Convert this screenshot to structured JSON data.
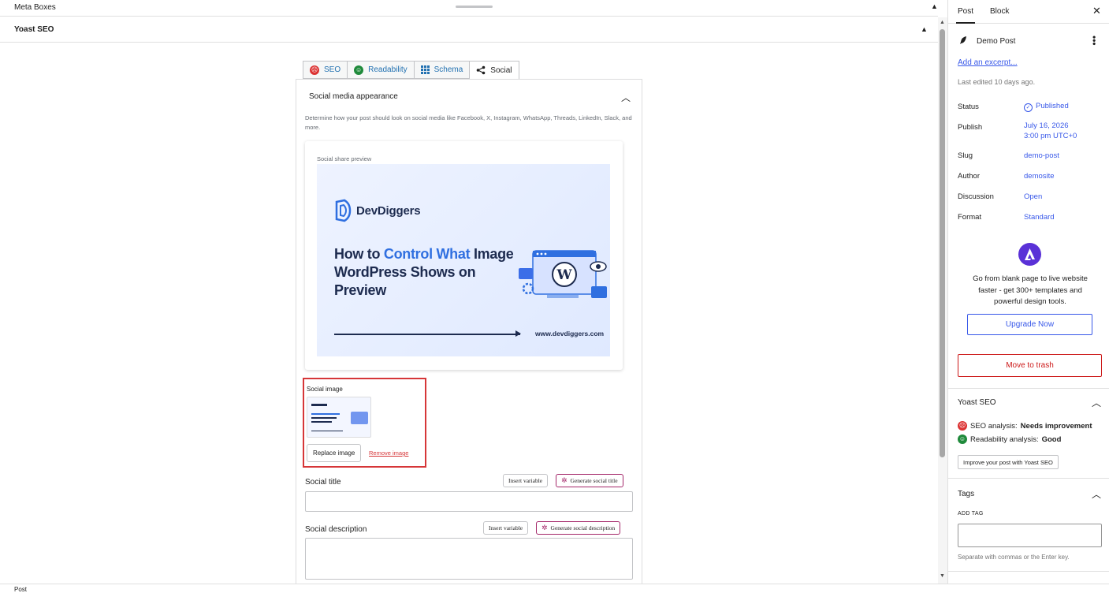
{
  "meta_boxes": {
    "label": "Meta Boxes"
  },
  "yoast_box": {
    "label": "Yoast SEO"
  },
  "tabs": [
    {
      "label": "SEO",
      "icon": "sad-face-icon"
    },
    {
      "label": "Readability",
      "icon": "happy-face-icon"
    },
    {
      "label": "Schema",
      "icon": "grid-icon"
    },
    {
      "label": "Social",
      "icon": "share-icon"
    }
  ],
  "social": {
    "section_title": "Social media appearance",
    "description": "Determine how your post should look on social media like Facebook, X, Instagram, WhatsApp, Threads, LinkedIn, Slack, and more.",
    "preview_title": "Social share preview",
    "preview": {
      "brand": "DevDiggers",
      "headline_pre": "How to ",
      "headline_highlight": "Control What",
      "headline_post": " Image WordPress Shows on Preview",
      "site": "www.devdiggers.com"
    },
    "image_label": "Social image",
    "replace_label": "Replace image",
    "remove_label": "Remove image",
    "title_label": "Social title",
    "desc_label": "Social description",
    "insert_variable": "Insert variable",
    "generate_title": "Generate social title",
    "generate_desc": "Generate social description",
    "title_value": "",
    "desc_value": ""
  },
  "footer": {
    "label": "Post"
  },
  "sidebar": {
    "tab_post": "Post",
    "tab_block": "Block",
    "post_name": "Demo Post",
    "excerpt_link": "Add an excerpt...",
    "last_edited": "Last edited 10 days ago.",
    "rows": {
      "status_k": "Status",
      "status_v": "Published",
      "publish_k": "Publish",
      "publish_v1": "July 16, 2026",
      "publish_v2": "3:00 pm UTC+0",
      "slug_k": "Slug",
      "slug_v": "demo-post",
      "author_k": "Author",
      "author_v": "demosite",
      "discussion_k": "Discussion",
      "discussion_v": "Open",
      "format_k": "Format",
      "format_v": "Standard"
    },
    "promo": "Go from blank page to live website faster - get 300+ templates and powerful design tools.",
    "upgrade": "Upgrade Now",
    "trash": "Move to trash",
    "yoast_title": "Yoast SEO",
    "seo_analysis_k": "SEO analysis:",
    "seo_analysis_v": "Needs improvement",
    "read_analysis_k": "Readability analysis:",
    "read_analysis_v": "Good",
    "improve_btn": "Improve your post with Yoast SEO",
    "tags_title": "Tags",
    "add_tag": "ADD TAG",
    "tag_help": "Separate with commas or the Enter key."
  },
  "colors": {
    "accent": "#3858e9",
    "danger": "#cc1818",
    "yoast_link": "#2271b1",
    "brand_blue": "#2f6fe0"
  }
}
